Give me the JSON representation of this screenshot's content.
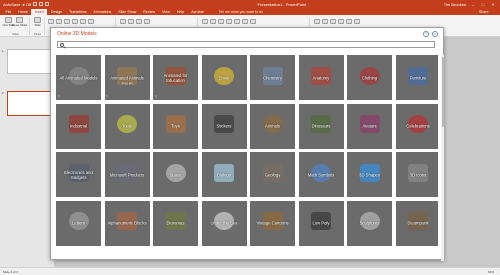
{
  "titlebar": {
    "autosave": "AutoSave",
    "autosave_state": "● Off",
    "title": "Presentation1 - PowerPoint",
    "user": "Tim Brookes",
    "minimize": "–",
    "maximize": "□",
    "close": "✕"
  },
  "tabs": [
    "File",
    "Home",
    "Insert",
    "Design",
    "Transitions",
    "Animations",
    "Slide Show",
    "Review",
    "View",
    "Help",
    "Acrobat"
  ],
  "tell_me": "Tell me what you want to do",
  "share": "Share",
  "ribbon_groups": {
    "slides": {
      "new_slide": "New Slide",
      "reuse": "Reuse Slides",
      "label": "Slides"
    },
    "tables": {
      "table": "Table",
      "label": "Tables"
    }
  },
  "slide_numbers": [
    "1",
    "2"
  ],
  "status": {
    "left": "Slide 2 of 2",
    "zoom": "64%"
  },
  "dialog": {
    "title": "Online 3D Models",
    "ctrl_help": "?",
    "ctrl_close": "×",
    "search_placeholder": ""
  },
  "tiles": [
    {
      "label": "All Animated Models",
      "badge": "▷"
    },
    {
      "label": "Animated Animals",
      "sub": "Free All",
      "badge": "▷"
    },
    {
      "label": "Animated for Education",
      "badge": "▷"
    },
    {
      "label": "Emoji"
    },
    {
      "label": "Chemistry"
    },
    {
      "label": "Anatomy"
    },
    {
      "label": "Clothing"
    },
    {
      "label": "Furniture"
    },
    {
      "label": "Industrial"
    },
    {
      "label": "Tools"
    },
    {
      "label": "Toys"
    },
    {
      "label": "Stickers"
    },
    {
      "label": "Animals"
    },
    {
      "label": "Dinosaurs"
    },
    {
      "label": "Avatars"
    },
    {
      "label": "Celebrations"
    },
    {
      "label": "Electronics and Gadgets"
    },
    {
      "label": "Microsoft Products"
    },
    {
      "label": "Space"
    },
    {
      "label": "Biology"
    },
    {
      "label": "Geology"
    },
    {
      "label": "Math Symbols"
    },
    {
      "label": "3D Shapes"
    },
    {
      "label": "3D Icons"
    },
    {
      "label": "Letters"
    },
    {
      "label": "Alphanumeric Blocks"
    },
    {
      "label": "Dioramas"
    },
    {
      "label": "Under the Sea"
    },
    {
      "label": "Vintage Cartoons"
    },
    {
      "label": "Low Poly"
    },
    {
      "label": "Sculptures"
    },
    {
      "label": "Steampunk"
    }
  ],
  "colors": {
    "accent": "#c43e1c",
    "tile_bg": "#6b6b6b"
  }
}
